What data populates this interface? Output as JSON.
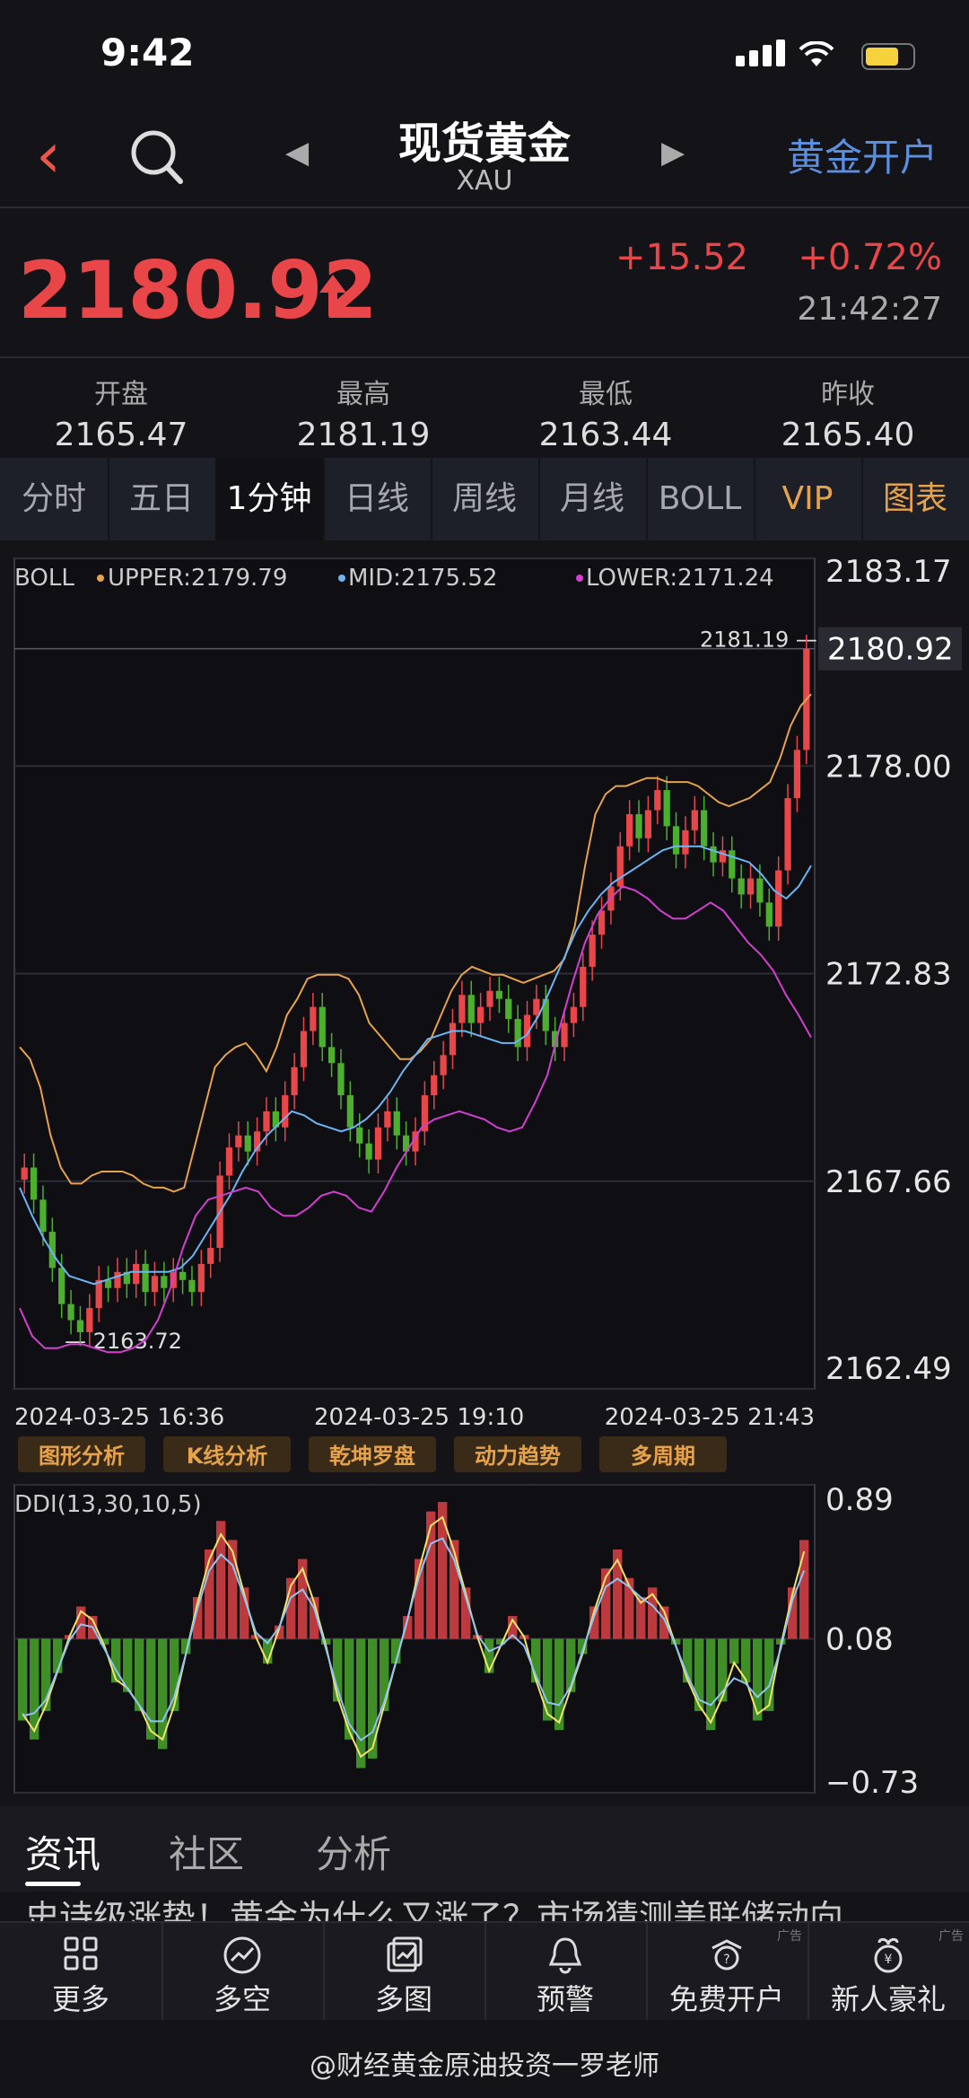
{
  "status": {
    "time": "9:42"
  },
  "header": {
    "title": "现货黄金",
    "subtitle": "XAU",
    "open_account": "黄金开户"
  },
  "price": {
    "last": "2180.92",
    "change": "+15.52",
    "change_pct": "+0.72%",
    "time": "21:42:27"
  },
  "stats": [
    {
      "label": "开盘",
      "value": "2165.47"
    },
    {
      "label": "最高",
      "value": "2181.19"
    },
    {
      "label": "最低",
      "value": "2163.44"
    },
    {
      "label": "昨收",
      "value": "2165.40"
    }
  ],
  "tabs": [
    "分时",
    "五日",
    "1分钟",
    "日线",
    "周线",
    "月线",
    "BOLL",
    "VIP",
    "图表"
  ],
  "active_tab": "1分钟",
  "chart_data": [
    {
      "type": "candlestick",
      "indicator": "BOLL",
      "legend": {
        "upper": "UPPER:2179.79",
        "mid": "MID:2175.52",
        "lower": "LOWER:2171.24"
      },
      "y_ticks": [
        "2183.17",
        "2178.00",
        "2172.83",
        "2167.66",
        "2162.49"
      ],
      "ylim": [
        2162.49,
        2183.17
      ],
      "x_labels": [
        "2024-03-25 16:36",
        "2024-03-25 19:10",
        "2024-03-25 21:43"
      ],
      "current_price_label": "2180.92",
      "high_annotation": "2181.19",
      "low_annotation": "2163.72",
      "close_series": [
        2168.0,
        2167.2,
        2166.4,
        2165.5,
        2164.6,
        2164.2,
        2163.9,
        2164.5,
        2165.2,
        2165.0,
        2165.4,
        2165.1,
        2165.6,
        2164.9,
        2165.3,
        2165.0,
        2165.4,
        2165.2,
        2164.9,
        2165.6,
        2166.0,
        2167.8,
        2168.5,
        2168.8,
        2168.4,
        2168.9,
        2169.4,
        2169.0,
        2169.8,
        2170.5,
        2171.4,
        2172.0,
        2171.0,
        2170.6,
        2169.8,
        2169.0,
        2168.6,
        2168.2,
        2169.0,
        2169.4,
        2168.8,
        2168.4,
        2168.9,
        2169.8,
        2170.3,
        2170.8,
        2171.6,
        2172.3,
        2171.6,
        2172.0,
        2172.4,
        2172.2,
        2171.7,
        2171.0,
        2171.8,
        2172.2,
        2171.4,
        2171.0,
        2171.6,
        2172.0,
        2173.0,
        2173.8,
        2174.4,
        2175.0,
        2176.0,
        2176.8,
        2176.2,
        2176.9,
        2177.4,
        2176.5,
        2175.8,
        2176.4,
        2176.9,
        2176.0,
        2175.6,
        2175.9,
        2175.2,
        2174.8,
        2175.2,
        2174.6,
        2174.0,
        2175.4,
        2177.2,
        2178.4,
        2180.92
      ],
      "upper_series": [
        2171.0,
        2170.7,
        2170.0,
        2168.8,
        2168.0,
        2167.6,
        2167.6,
        2167.8,
        2167.9,
        2167.9,
        2167.9,
        2167.8,
        2167.6,
        2167.5,
        2167.5,
        2167.4,
        2167.5,
        2168.5,
        2169.5,
        2170.5,
        2170.8,
        2171.0,
        2171.1,
        2170.8,
        2170.4,
        2171.0,
        2171.8,
        2172.2,
        2172.7,
        2172.8,
        2172.8,
        2172.8,
        2172.7,
        2172.3,
        2171.6,
        2171.3,
        2171.0,
        2170.7,
        2170.7,
        2170.9,
        2171.2,
        2171.8,
        2172.4,
        2172.8,
        2173.0,
        2172.9,
        2172.8,
        2172.8,
        2172.7,
        2172.6,
        2172.7,
        2172.8,
        2172.9,
        2173.2,
        2174.0,
        2175.5,
        2176.8,
        2177.3,
        2177.5,
        2177.5,
        2177.6,
        2177.7,
        2177.7,
        2177.6,
        2177.6,
        2177.6,
        2177.5,
        2177.3,
        2177.1,
        2177.0,
        2177.1,
        2177.2,
        2177.4,
        2177.6,
        2178.2,
        2179.0,
        2179.5,
        2179.79
      ],
      "mid_series": [
        2167.5,
        2166.8,
        2166.2,
        2165.7,
        2165.3,
        2165.2,
        2165.1,
        2165.2,
        2165.3,
        2165.4,
        2165.4,
        2165.4,
        2165.4,
        2165.5,
        2165.8,
        2166.3,
        2166.8,
        2167.3,
        2167.9,
        2168.4,
        2168.8,
        2169.1,
        2169.4,
        2169.3,
        2169.1,
        2169.0,
        2168.9,
        2169.0,
        2169.2,
        2169.5,
        2169.9,
        2170.4,
        2170.8,
        2171.2,
        2171.3,
        2171.4,
        2171.4,
        2171.3,
        2171.2,
        2171.1,
        2171.1,
        2171.3,
        2171.8,
        2172.5,
        2173.2,
        2173.9,
        2174.4,
        2174.8,
        2175.1,
        2175.3,
        2175.5,
        2175.7,
        2175.9,
        2176.0,
        2176.0,
        2176.0,
        2175.9,
        2175.8,
        2175.7,
        2175.6,
        2175.3,
        2174.9,
        2174.7,
        2175.0,
        2175.52
      ],
      "lower_series": [
        2164.5,
        2163.8,
        2163.5,
        2163.5,
        2163.6,
        2163.6,
        2163.5,
        2163.4,
        2163.4,
        2163.5,
        2163.7,
        2164.2,
        2165.0,
        2166.0,
        2166.8,
        2167.2,
        2167.3,
        2167.4,
        2167.5,
        2167.4,
        2167.0,
        2166.8,
        2166.8,
        2167.0,
        2167.3,
        2167.4,
        2167.3,
        2167.0,
        2166.9,
        2167.4,
        2168.0,
        2168.5,
        2169.0,
        2169.2,
        2169.3,
        2169.4,
        2169.3,
        2169.2,
        2169.0,
        2168.9,
        2169.0,
        2169.6,
        2170.3,
        2171.5,
        2172.6,
        2173.6,
        2174.3,
        2174.7,
        2175.0,
        2174.9,
        2174.7,
        2174.4,
        2174.2,
        2174.2,
        2174.4,
        2174.6,
        2174.4,
        2174.0,
        2173.6,
        2173.3,
        2172.9,
        2172.3,
        2171.8,
        2171.24
      ],
      "toolbar_buttons": [
        "图形分析",
        "K线分析",
        "乾坤罗盘",
        "动力趋势",
        "多周期"
      ]
    },
    {
      "type": "bar",
      "indicator": "DDI(13,30,10,5)",
      "y_ticks": [
        "0.89",
        "0.08",
        "−0.73"
      ],
      "ylim": [
        -0.73,
        0.89
      ],
      "values": [
        -0.35,
        -0.45,
        -0.3,
        -0.1,
        0.1,
        0.25,
        0.2,
        0.05,
        -0.15,
        -0.2,
        -0.3,
        -0.45,
        -0.5,
        -0.3,
        0.0,
        0.3,
        0.55,
        0.7,
        0.6,
        0.35,
        0.1,
        -0.05,
        0.15,
        0.4,
        0.5,
        0.3,
        0.05,
        -0.25,
        -0.45,
        -0.6,
        -0.55,
        -0.3,
        -0.05,
        0.2,
        0.5,
        0.75,
        0.8,
        0.6,
        0.35,
        0.1,
        -0.1,
        0.05,
        0.2,
        0.1,
        -0.15,
        -0.35,
        -0.4,
        -0.2,
        0.0,
        0.25,
        0.45,
        0.55,
        0.4,
        0.3,
        0.35,
        0.25,
        0.05,
        -0.15,
        -0.3,
        -0.4,
        -0.25,
        -0.05,
        -0.15,
        -0.35,
        -0.3,
        0.05,
        0.35,
        0.6
      ]
    }
  ],
  "sec_tabs": [
    "资讯",
    "社区",
    "分析"
  ],
  "news_headline": "史诗级涨势！黄金为什么又涨了？市场猜测美联储动向",
  "bottom_nav": [
    {
      "label": "更多",
      "icon": "grid-icon"
    },
    {
      "label": "多空",
      "icon": "trend-icon"
    },
    {
      "label": "多图",
      "icon": "multi-chart-icon"
    },
    {
      "label": "预警",
      "icon": "bell-icon"
    },
    {
      "label": "免费开户",
      "icon": "account-icon",
      "ad": "广告"
    },
    {
      "label": "新人豪礼",
      "icon": "gift-icon",
      "ad": "广告"
    }
  ],
  "watermark": "@财经黄金原油投资一罗老师",
  "colors": {
    "up": "#e9464a",
    "down": "#4caf2e",
    "upper": "#e7a24c",
    "mid": "#6cb5f5",
    "lower": "#d23fd1",
    "accent_blue": "#5b8fe0",
    "vip": "#e7a24c"
  }
}
